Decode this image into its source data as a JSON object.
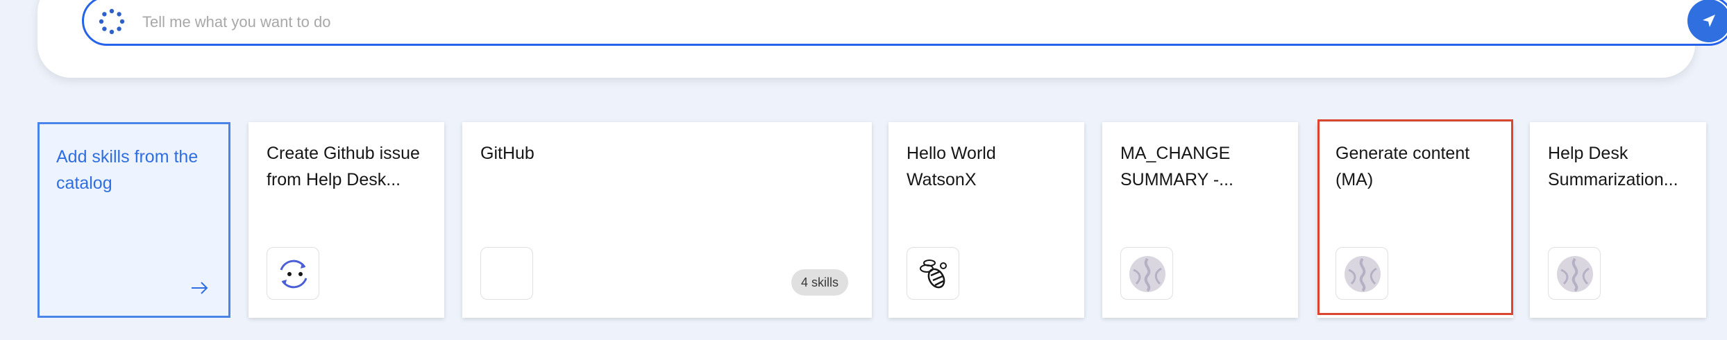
{
  "prompt": {
    "placeholder": "Tell me what you want to do",
    "value": "",
    "send_icon": "send-icon",
    "status_icon": "loading-spinner-icon",
    "accent_color": "#2563eb"
  },
  "cards": [
    {
      "id": "add-skills",
      "title": "Add skills from the catalog",
      "icon": "arrow-right-icon",
      "kind": "add"
    },
    {
      "id": "create-github-issue",
      "title": "Create Github issue from Help Desk...",
      "icon": "sync-icon"
    },
    {
      "id": "github",
      "title": "GitHub",
      "icon": "blank-icon",
      "badge": "4 skills"
    },
    {
      "id": "hello-world-watsonx",
      "title": "Hello World WatsonX",
      "icon": "bee-icon"
    },
    {
      "id": "ma-change-summary",
      "title": "MA_CHANGE SUMMARY -...",
      "icon": "marble-icon"
    },
    {
      "id": "generate-content-ma",
      "title": "Generate content (MA)",
      "icon": "marble-icon",
      "selected": true
    },
    {
      "id": "help-desk-summarization",
      "title": "Help Desk Summarization...",
      "icon": "marble-icon"
    }
  ],
  "colors": {
    "background": "#eef3fb",
    "selection_outline": "#d9452f",
    "link_blue": "#2f6ee0"
  }
}
